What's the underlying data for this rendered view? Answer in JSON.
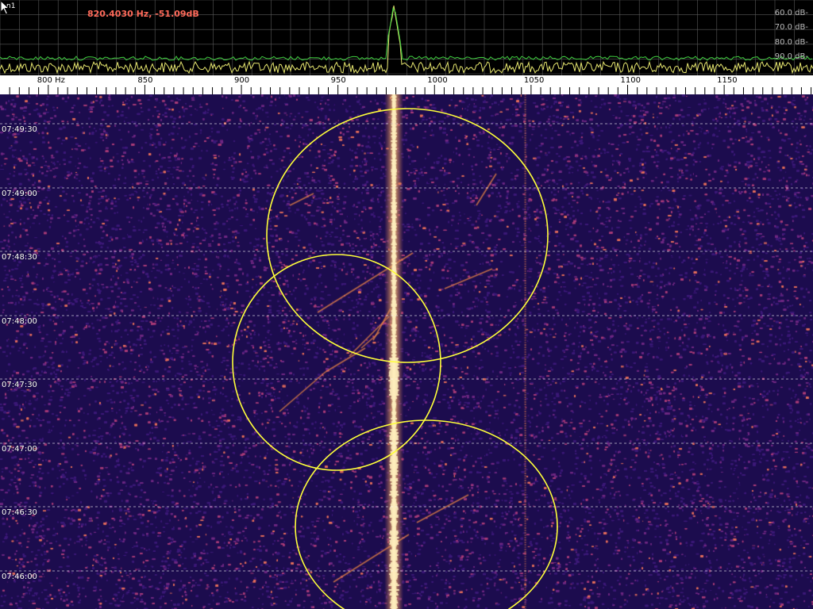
{
  "window": {
    "corner_label": "n1",
    "readout": "820.4030 Hz, -51.09dB"
  },
  "spectrum": {
    "db_labels": [
      "60.0 dB-",
      "70.0 dB-",
      "80.0 dB-",
      "90.0 dB-"
    ],
    "peak_frequency_hz": 979,
    "colors": {
      "trace_avg": "#3fcf3f",
      "trace_inst": "#e8e870",
      "grid": "#5a5a5a"
    }
  },
  "frequency_axis": {
    "labels": [
      "800 Hz",
      "850",
      "900",
      "950",
      "1000",
      "1050",
      "1100",
      "1150"
    ],
    "min_hz": 775,
    "max_hz": 1196
  },
  "waterfall": {
    "time_labels": [
      "07:49:30",
      "07:49:00",
      "07:48:30",
      "07:48:00",
      "07:47:30",
      "07:47:00",
      "07:46:30",
      "07:46:00"
    ],
    "carrier_hz": 979,
    "faint_carrier_hz": 1047,
    "colors": {
      "bg": "#1c0c4e",
      "noise_hi": "#c04a6a",
      "carrier": "#fff3c0",
      "circle": "#ffff3a"
    }
  }
}
